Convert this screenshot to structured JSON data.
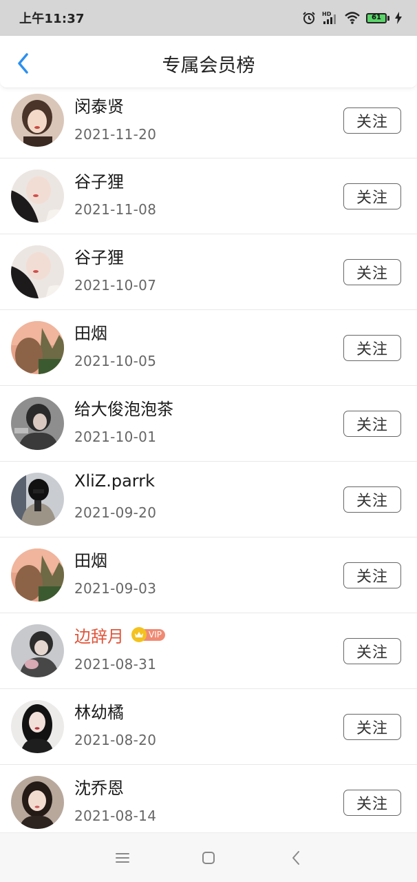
{
  "status_bar": {
    "time": "上午11:37",
    "battery_level": "61",
    "icons": [
      "alarm-icon",
      "hd-signal-icon",
      "wifi-icon",
      "battery-icon",
      "charging-icon"
    ]
  },
  "header": {
    "title": "专属会员榜",
    "back_icon": "chevron-left-icon",
    "accent_color": "#2b8ff0"
  },
  "members": [
    {
      "name": "闵泰贤",
      "date": "2021-11-20",
      "follow_label": "关注",
      "vip": false
    },
    {
      "name": "谷子狸",
      "date": "2021-11-08",
      "follow_label": "关注",
      "vip": false
    },
    {
      "name": "谷子狸",
      "date": "2021-10-07",
      "follow_label": "关注",
      "vip": false
    },
    {
      "name": "田烟",
      "date": "2021-10-05",
      "follow_label": "关注",
      "vip": false
    },
    {
      "name": "给大俊泡泡茶",
      "date": "2021-10-01",
      "follow_label": "关注",
      "vip": false
    },
    {
      "name": "XliZ.parrk",
      "date": "2021-09-20",
      "follow_label": "关注",
      "vip": false
    },
    {
      "name": "田烟",
      "date": "2021-09-03",
      "follow_label": "关注",
      "vip": false
    },
    {
      "name": "边辞月",
      "date": "2021-08-31",
      "follow_label": "关注",
      "vip": true,
      "vip_label": "VIP"
    },
    {
      "name": "林幼橘",
      "date": "2021-08-20",
      "follow_label": "关注",
      "vip": false
    },
    {
      "name": "沈乔恩",
      "date": "2021-08-14",
      "follow_label": "关注",
      "vip": false
    }
  ],
  "colors": {
    "vip_name": "#e0553b",
    "vip_tag": "#f08a73",
    "vip_crown": "#f4c21f"
  },
  "nav_bar": {
    "icons": [
      "menu-icon",
      "home-icon",
      "back-icon"
    ]
  }
}
